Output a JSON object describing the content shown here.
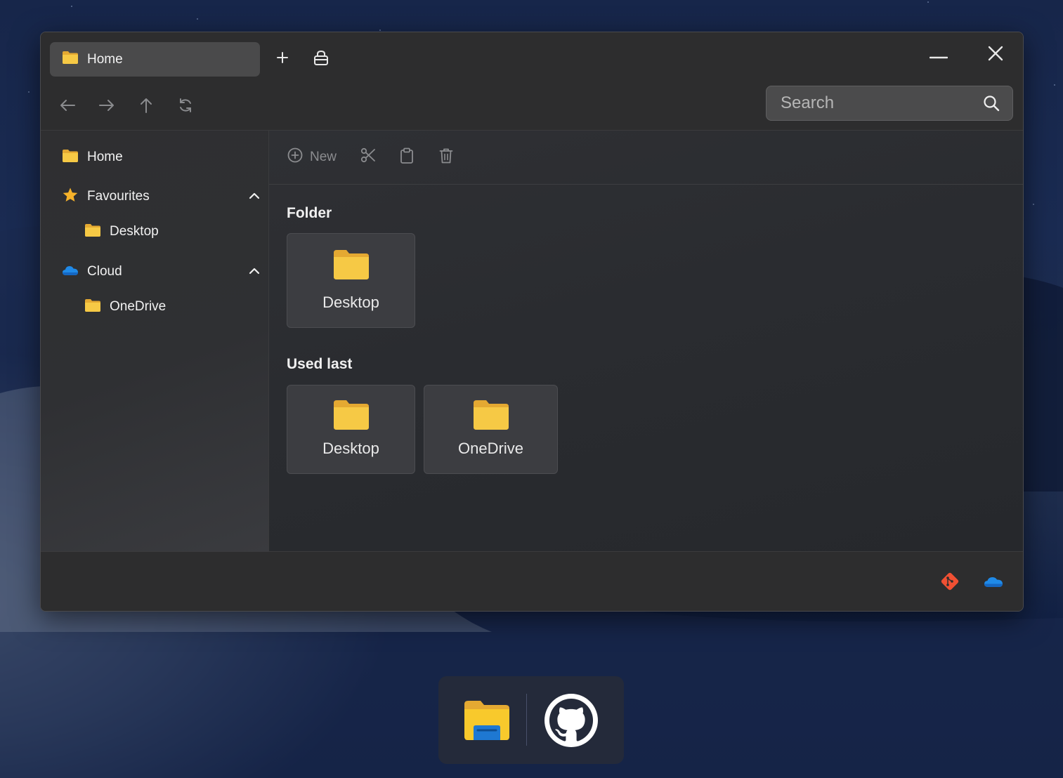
{
  "window": {
    "tab": {
      "label": "Home",
      "icon": "folder-icon"
    },
    "new_tab_icon": "plus-icon",
    "lock_icon": "lock-icon",
    "minimize_icon": "minimize-icon",
    "close_icon": "close-icon"
  },
  "navigation": {
    "buttons": [
      "back-arrow-icon",
      "forward-arrow-icon",
      "up-arrow-icon",
      "refresh-icon"
    ],
    "search": {
      "placeholder": "Search",
      "value": ""
    }
  },
  "sidebar": {
    "items": [
      {
        "label": "Home",
        "icon": "folder-icon"
      },
      {
        "label": "Favourites",
        "icon": "star-icon",
        "expanded": true
      },
      {
        "label": "Desktop",
        "icon": "folder-icon"
      },
      {
        "label": "Cloud",
        "icon": "cloud-icon",
        "expanded": true
      },
      {
        "label": "OneDrive",
        "icon": "folder-icon"
      }
    ]
  },
  "toolbar": {
    "new_label": "New",
    "icons": [
      "plus-circle-icon",
      "scissors-icon",
      "clipboard-icon",
      "trash-icon"
    ]
  },
  "main": {
    "sections": [
      {
        "title": "Folder",
        "items": [
          "Desktop"
        ]
      },
      {
        "title": "Used last",
        "items": [
          "Desktop",
          "OneDrive"
        ]
      }
    ]
  },
  "statusbar": {
    "icons": [
      "git-icon",
      "onedrive-icon"
    ]
  },
  "dock": {
    "apps": [
      "file-explorer-icon",
      "github-icon"
    ]
  },
  "colors": {
    "folder": "#f6c945",
    "folder_back": "#e4a932",
    "git": "#f05033",
    "onedrive": "#1f8ae8",
    "star": "#f6b22a"
  }
}
